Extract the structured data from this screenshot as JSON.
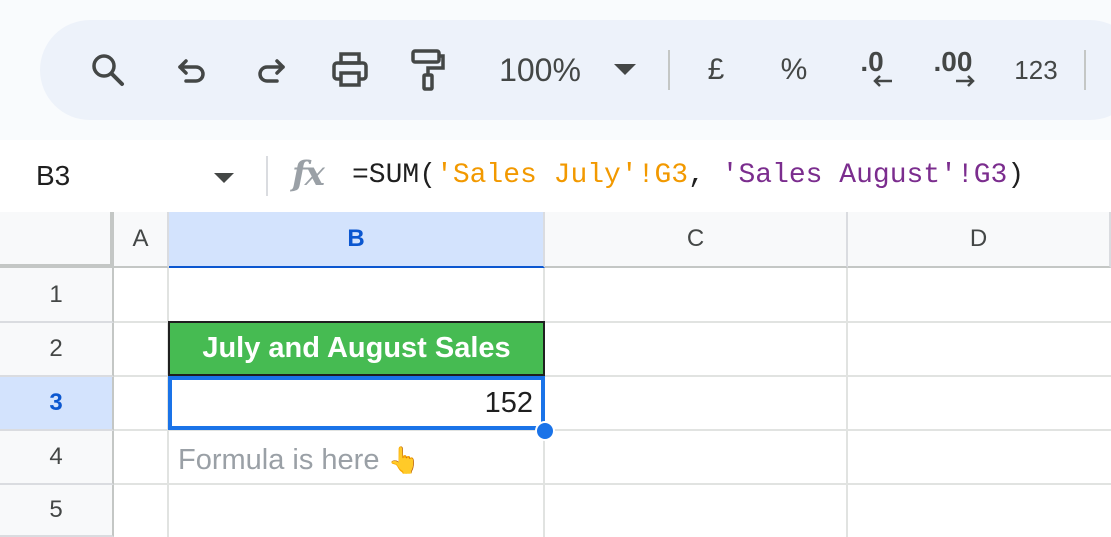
{
  "toolbar": {
    "zoom": "100%",
    "currency": "£",
    "percent": "%",
    "decrease_decimals": ".0",
    "increase_decimals": ".00",
    "number_format": "123",
    "icons": [
      "search-icon",
      "undo-icon",
      "redo-icon",
      "print-icon",
      "paint-format-icon",
      "chevron-down-icon",
      "arrow-left-icon",
      "arrow-right-icon"
    ]
  },
  "formula_bar": {
    "cell_ref": "B3",
    "fx": "fx",
    "formula_prefix": "=SUM(",
    "ref1": "'Sales July'!G3",
    "separator": ", ",
    "ref2": "'Sales August'!G3",
    "formula_suffix": ")"
  },
  "grid": {
    "columns": [
      "A",
      "B",
      "C",
      "D"
    ],
    "rows": [
      "1",
      "2",
      "3",
      "4",
      "5"
    ],
    "selected_column": "B",
    "selected_row": "3"
  },
  "cells": {
    "B2": "July and August Sales",
    "B3": "152",
    "B4": "Formula is here",
    "B4_emoji": "👆"
  },
  "colors": {
    "header_fill": "#46bb52",
    "selection": "#1a73e8",
    "ref1": "#f29900",
    "ref2": "#7b2d8e"
  }
}
